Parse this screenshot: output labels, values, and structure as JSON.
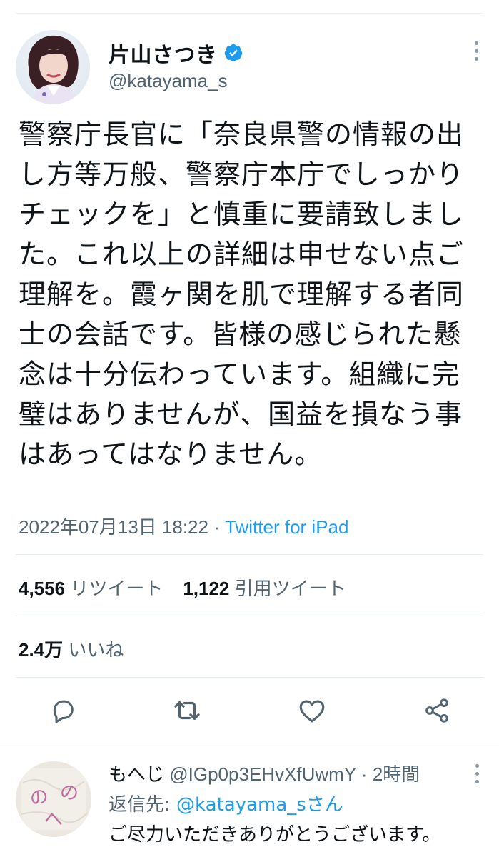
{
  "tweet": {
    "author": {
      "display_name": "片山さつき",
      "handle": "@katayama_s",
      "verified": true
    },
    "text": "警察庁長官に「奈良県警の情報の出し方等万般、警察庁本庁でしっかりチェックを」と慎重に要請致しました。これ以上の詳細は申せない点ご理解を。霞ヶ関を肌で理解する者同士の会話です。皆様の感じられた懸念は十分伝わっています。組織に完璧はありませんが、国益を損なう事はあってはなりません。",
    "timestamp": "2022年07月13日 18:22",
    "separator": " · ",
    "source": "Twitter for iPad",
    "retweets": {
      "count": "4,556",
      "label": "リツイート"
    },
    "quotes": {
      "count": "1,122",
      "label": "引用ツイート"
    },
    "likes": {
      "count": "2.4万",
      "label": "いいね"
    }
  },
  "actions": [
    "reply-icon",
    "retweet-icon",
    "like-icon",
    "share-icon"
  ],
  "reply": {
    "display_name": "もへじ",
    "handle": "@IGp0p3EHvXfUwmY",
    "separator": " · ",
    "time": "2時間",
    "reply_to_prefix": "返信先: ",
    "reply_to_handle": "@katayama_s",
    "reply_to_suffix": "さん",
    "text": "ご尽力いただきありがとうございます。"
  },
  "colors": {
    "text": "#0f1419",
    "secondary": "#536471",
    "accent": "#1d9bf0",
    "divider": "#e6ecf0"
  }
}
